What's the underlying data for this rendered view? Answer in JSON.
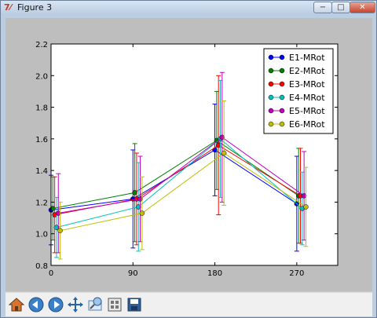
{
  "window": {
    "title": "Figure 3",
    "app_icon": "tk-feather-icon",
    "minimize_symbol": "−",
    "maximize_symbol": "□",
    "close_symbol": "✕"
  },
  "colors": {
    "window_frame": "#bdcde0",
    "figure_bg": "#bebebe",
    "axes_bg": "#ffffff",
    "toolbar_bg": "#f0f0f0"
  },
  "toolbar": {
    "buttons": [
      "home-icon",
      "back-icon",
      "forward-icon",
      "pan-icon",
      "zoom-icon",
      "subplots-icon",
      "save-icon"
    ]
  },
  "chart_data": {
    "type": "line",
    "title": "",
    "xlabel": "",
    "ylabel": "",
    "xlim": [
      0,
      315
    ],
    "ylim": [
      0.8,
      2.2
    ],
    "xticks": [
      0,
      90,
      180,
      270
    ],
    "xtick_labels": [
      "0",
      "90",
      "180",
      "270"
    ],
    "yticks": [
      0.8,
      1.0,
      1.2,
      1.4,
      1.6,
      1.8,
      2.0,
      2.2
    ],
    "ytick_labels": [
      "0.8",
      "1.0",
      "1.2",
      "1.4",
      "1.6",
      "1.8",
      "2.0",
      "2.2"
    ],
    "grid": false,
    "legend_position": "top-right",
    "error_bars": true,
    "series": [
      {
        "name": "E1-MRot",
        "color": "#0000ff",
        "x": [
          0,
          90,
          180,
          270
        ],
        "y": [
          1.15,
          1.22,
          1.53,
          1.19
        ],
        "err": [
          0.22,
          0.31,
          0.29,
          0.3
        ]
      },
      {
        "name": "E2-MRot",
        "color": "#007f00",
        "x": [
          2,
          92,
          182,
          272
        ],
        "y": [
          1.16,
          1.26,
          1.59,
          1.24
        ],
        "err": [
          0.2,
          0.31,
          0.31,
          0.3
        ]
      },
      {
        "name": "E3-MRot",
        "color": "#ff0000",
        "x": [
          4,
          94,
          184,
          274
        ],
        "y": [
          1.12,
          1.22,
          1.56,
          1.24
        ],
        "err": [
          0.24,
          0.29,
          0.44,
          0.3
        ]
      },
      {
        "name": "E4-MRot",
        "color": "#00bfbf",
        "x": [
          6,
          96,
          186,
          276
        ],
        "y": [
          1.04,
          1.17,
          1.6,
          1.16
        ],
        "err": [
          0.19,
          0.28,
          0.37,
          0.23
        ]
      },
      {
        "name": "E5-MRot",
        "color": "#bf00bf",
        "x": [
          8,
          98,
          188,
          278
        ],
        "y": [
          1.13,
          1.22,
          1.61,
          1.24
        ],
        "err": [
          0.25,
          0.27,
          0.41,
          0.28
        ]
      },
      {
        "name": "E6-MRot",
        "color": "#bfbf00",
        "x": [
          10,
          100,
          190,
          280
        ],
        "y": [
          1.02,
          1.13,
          1.51,
          1.17
        ],
        "err": [
          0.18,
          0.23,
          0.33,
          0.25
        ]
      }
    ]
  }
}
